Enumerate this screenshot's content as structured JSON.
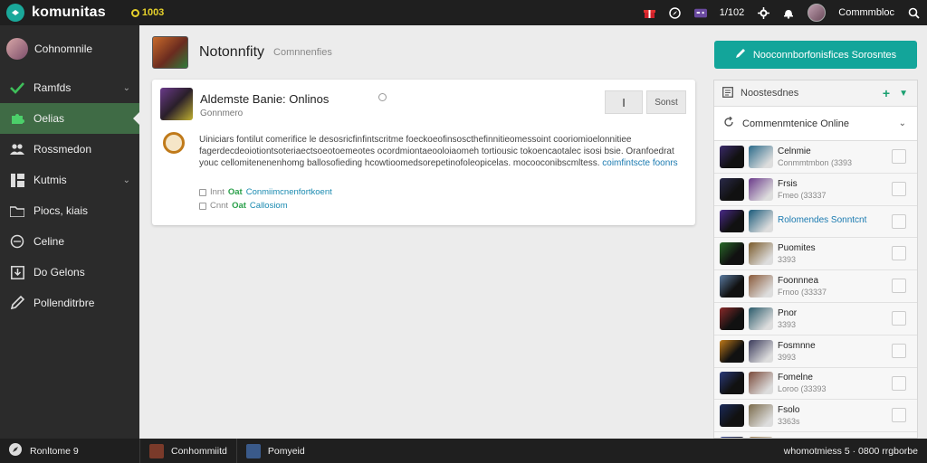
{
  "app": {
    "brand": "komunitas",
    "coins": "1003"
  },
  "topbar": {
    "count": "1/102",
    "username": "Commmbloc"
  },
  "sidebar": {
    "items": [
      {
        "label": "Cohnomnile",
        "icon": "avatar",
        "chevron": ""
      },
      {
        "label": "Ramfds",
        "icon": "check-icon",
        "chevron": "⌄"
      },
      {
        "label": "Oelias",
        "icon": "puzzle-icon",
        "chevron": "",
        "active": true
      },
      {
        "label": "Rossmedon",
        "icon": "people-icon",
        "chevron": ""
      },
      {
        "label": "Kutmis",
        "icon": "grid-icon",
        "chevron": "⌄"
      },
      {
        "label": "Piocs, kiais",
        "icon": "folder-icon",
        "chevron": ""
      },
      {
        "label": "Celine",
        "icon": "globe-icon",
        "chevron": ""
      },
      {
        "label": "Do Gelons",
        "icon": "download-icon",
        "chevron": ""
      },
      {
        "label": "Pollenditrbre",
        "icon": "pen-icon",
        "chevron": ""
      }
    ]
  },
  "main": {
    "title": "Notonnfity",
    "subtitle": "Comnnenfies"
  },
  "post": {
    "title": "Aldemste Banie: Onlinos",
    "author": "Gonnmero",
    "btn_icon": "I",
    "btn_sort": "Sonst",
    "body_before": "Uiniciars fontilut comerifice le desosricfinfintscritme foeckoeofinsoscthefinnitieomessoint cooriomioelonnitiee fagerdecdeoiotiontsoteriaectsoeotoemeotes ocordmiontaeooloiaomeh tortiousic tokoencaotalec isosi bsie. Oranfoedrat youc cellomitenenenhomg ballosofieding hcowtioomedsorepetinofoleopicelas. mocooconibscmltess.",
    "body_link": "coimfintscte foonrs",
    "meta": [
      {
        "label": "Innt",
        "tag": "Oat",
        "link": "Conmiimcnenfortkoent"
      },
      {
        "label": "Cnnt",
        "tag": "Oat",
        "link": "Callosiom"
      }
    ]
  },
  "right": {
    "join_label": "Nooconnborfonisfices Sorosntes",
    "header": "Noostesdnes",
    "select_label": "Commenmtenice Online",
    "rows": [
      {
        "name": "Celnmie",
        "sub": "Conmmtmbon (3393",
        "accent": false,
        "c1": "#3a2a6a",
        "c2": "#2a6a8a"
      },
      {
        "name": "Frsis",
        "sub": "Fmeo (33337",
        "accent": false,
        "c1": "#2a2a4a",
        "c2": "#6a3a8a"
      },
      {
        "name": "Rolomendes Sonntcnt",
        "sub": "",
        "accent": true,
        "c1": "#4a2a8a",
        "c2": "#1a5a7a"
      },
      {
        "name": "Puomites",
        "sub": "3393",
        "accent": false,
        "c1": "#2a6a2a",
        "c2": "#7a5a2a"
      },
      {
        "name": "Foonnnea",
        "sub": "Frnoo (33337",
        "accent": false,
        "c1": "#5a7aa0",
        "c2": "#8a5a3a"
      },
      {
        "name": "Pnor",
        "sub": "3393",
        "accent": false,
        "c1": "#8a2a2a",
        "c2": "#2a5a6a"
      },
      {
        "name": "Fosmnne",
        "sub": "3993",
        "accent": false,
        "c1": "#c07a1a",
        "c2": "#3a3a5a"
      },
      {
        "name": "Fomelne",
        "sub": "Loroo (33393",
        "accent": false,
        "c1": "#2a3a7a",
        "c2": "#7a4a3a"
      },
      {
        "name": "Fsolo",
        "sub": "3363s",
        "accent": false,
        "c1": "#1a2a5a",
        "c2": "#7a6a4a"
      },
      {
        "name": "",
        "sub": "",
        "accent": false,
        "c1": "#2a3a8a",
        "c2": "#8a6a3a"
      }
    ]
  },
  "bottom": {
    "left_label": "Ronltome 9",
    "tabs": [
      {
        "label": "Conhommiitd",
        "c": "#7a3a2a"
      },
      {
        "label": "Pomyeid",
        "c": "#3a5a8a"
      }
    ],
    "right_label": "whomotmiess  5  · 0800 rrgborbe"
  },
  "colors": {
    "accent": "#13a59a",
    "active_bg": "#3f6b45",
    "sidebar_bg": "#2b2b2b"
  }
}
